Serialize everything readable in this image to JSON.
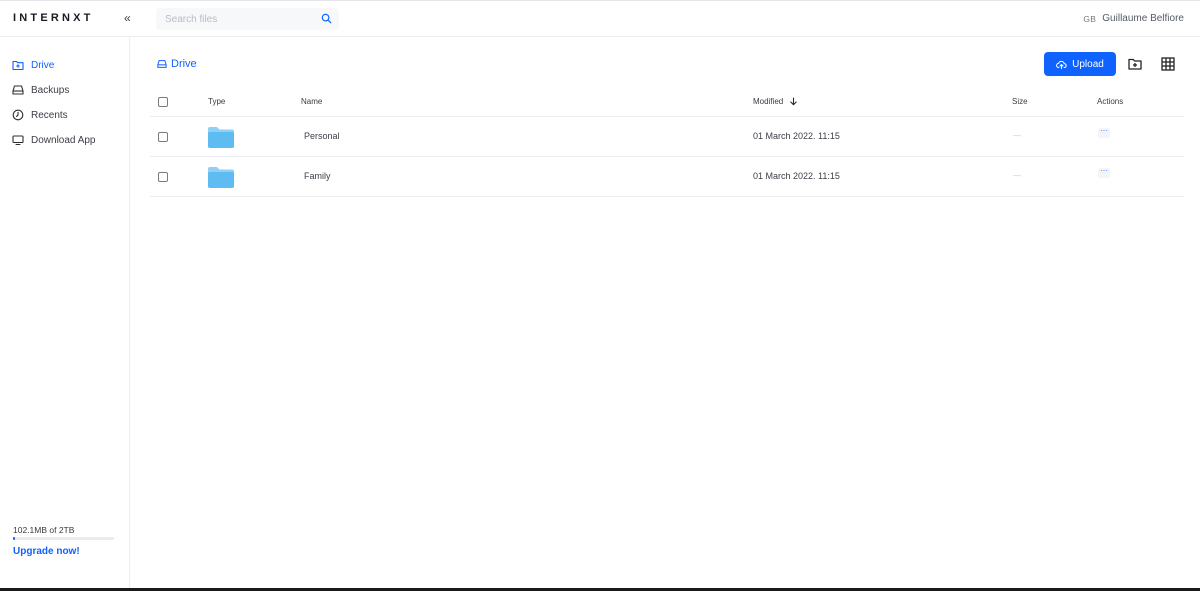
{
  "header": {
    "logo": "INTERNXT",
    "collapse_label": "«",
    "search_placeholder": "Search files",
    "user_initials": "GB",
    "user_name": "Guillaume Belfiore"
  },
  "sidebar": {
    "items": [
      {
        "label": "Drive",
        "icon": "folder-plus-icon",
        "active": true
      },
      {
        "label": "Backups",
        "icon": "hard-drive-icon",
        "active": false
      },
      {
        "label": "Recents",
        "icon": "clock-icon",
        "active": false
      },
      {
        "label": "Download App",
        "icon": "monitor-icon",
        "active": false
      }
    ],
    "usage_text": "102.1MB of 2TB",
    "usage_fraction": 0.01,
    "upgrade_label": "Upgrade now!"
  },
  "main": {
    "breadcrumb": "Drive",
    "upload_label": "Upload",
    "columns": {
      "type": "Type",
      "name": "Name",
      "modified": "Modified",
      "size": "Size",
      "actions": "Actions"
    },
    "rows": [
      {
        "name": "Personal",
        "modified": "01 March 2022. 11:15",
        "size": "—",
        "actions": "···"
      },
      {
        "name": "Family",
        "modified": "01 March 2022. 11:15",
        "size": "—",
        "actions": "···"
      }
    ]
  },
  "colors": {
    "accent": "#0f62fe",
    "folder": "#5ebcf3"
  }
}
